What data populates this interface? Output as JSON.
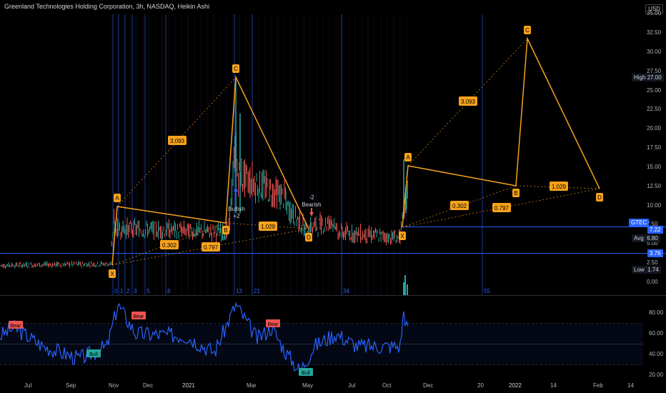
{
  "header": {
    "title": "Greenland Technologies Holding Corporation, 3h, NASDAQ, Heikin Ashi",
    "currency": "USD"
  },
  "price_axis": {
    "ticks": [
      "35.00",
      "32.50",
      "30.00",
      "27.50",
      "25.00",
      "22.50",
      "20.00",
      "17.50",
      "15.00",
      "12.50",
      "10.00",
      "7.50",
      "5.00",
      "2.50",
      "0.00"
    ],
    "high_label": "High",
    "high_value": "27.00",
    "symbol_label": "GTEC",
    "last_value": "7.22",
    "avg_label": "Avg",
    "avg_value": "6.80",
    "line_value": "3.76",
    "low_label": "Low",
    "low_value": "1.74"
  },
  "time_axis": [
    "Jul",
    "Sep",
    "Nov",
    "Dec",
    "2021",
    "Mar",
    "May",
    "Jul",
    "Oct",
    "Dec",
    "20",
    "2022",
    "14",
    "Feb",
    "14"
  ],
  "fib_numbers": [
    "0",
    "1",
    "2",
    "3",
    "5",
    "8",
    "13",
    "21",
    "34",
    "55"
  ],
  "pattern1": {
    "points": [
      "X",
      "A",
      "B",
      "C",
      "D"
    ],
    "ratios": [
      "3.093",
      "0.302",
      "0.797",
      "1.029"
    ]
  },
  "pattern2": {
    "points": [
      "X",
      "A",
      "B",
      "C",
      "D"
    ],
    "ratios": [
      "3.093",
      "0.302",
      "0.797",
      "1.029"
    ]
  },
  "signals": {
    "bullish_text": "Bullish",
    "bullish_count": "+2",
    "bearish_count": "-2",
    "bearish_text": "Bearish"
  },
  "oscillator": {
    "ticks": [
      "80.00",
      "60.00",
      "40.00",
      "20.00"
    ],
    "bear_label": "Bear",
    "bull_label": "Bull"
  },
  "colors": {
    "up": "#26a69a",
    "down": "#ef5350",
    "pattern": "#f7a21b",
    "blue": "#2962ff",
    "rsi": "#2962ff"
  }
}
